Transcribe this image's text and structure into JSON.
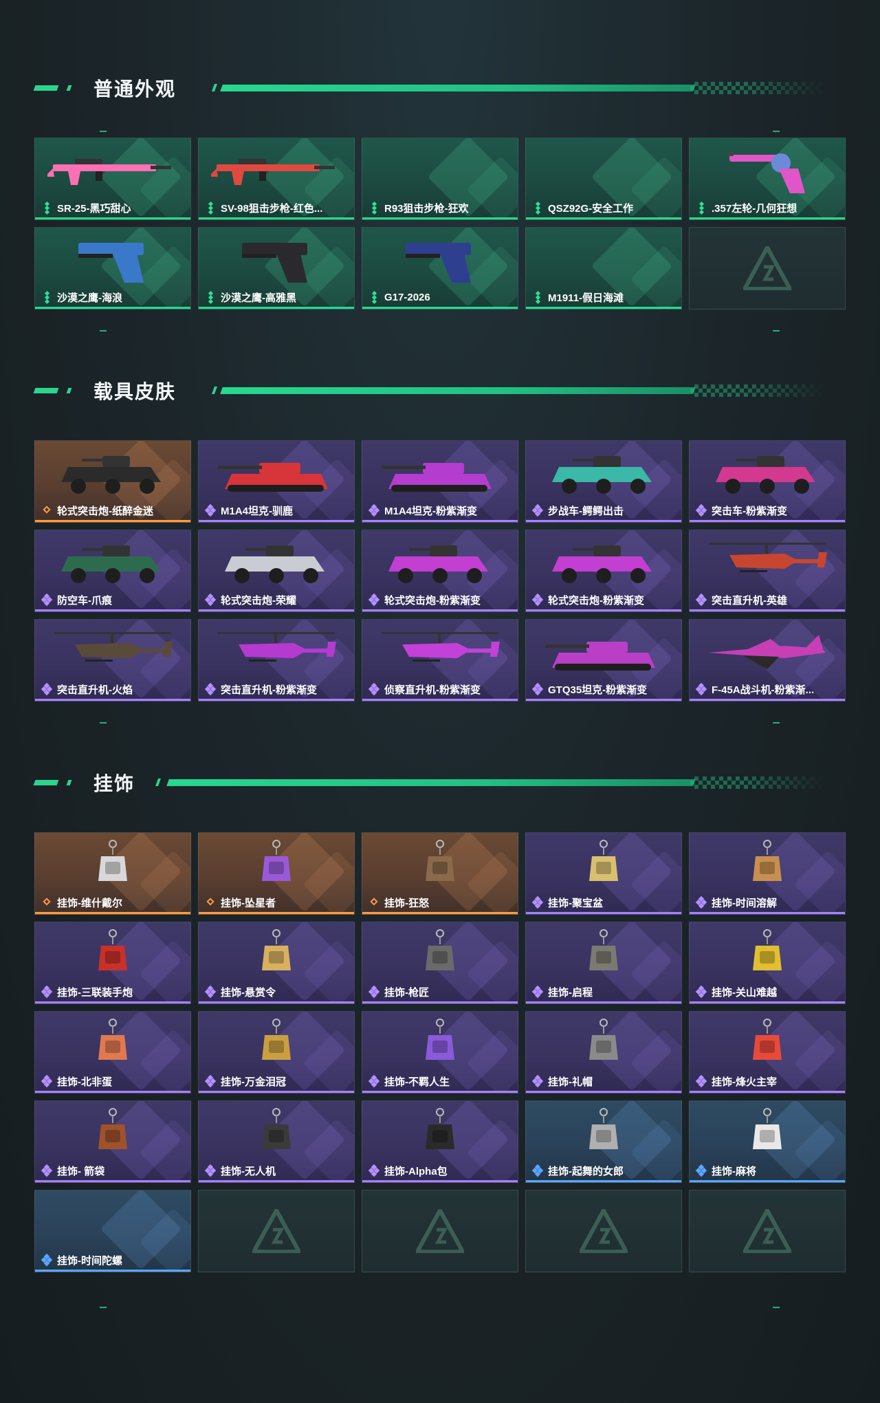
{
  "sections": [
    {
      "title": "普通外观",
      "items": [
        {
          "name": "SR-25-黑巧甜心",
          "tier": "green",
          "icon": "pink-rifle-icon",
          "color": "#ff6fb4"
        },
        {
          "name": "SV-98狙击步枪-红色...",
          "tier": "green",
          "icon": "red-sniper-rifle-icon",
          "color": "#e0493f"
        },
        {
          "name": "R93狙击步枪-狂欢",
          "tier": "green",
          "icon": "",
          "color": ""
        },
        {
          "name": "QSZ92G-安全工作",
          "tier": "green",
          "icon": "",
          "color": ""
        },
        {
          "name": ".357左轮-几何狂想",
          "tier": "green",
          "icon": "revolver-icon",
          "color": "#e056c8"
        },
        {
          "name": "沙漠之鹰-海浪",
          "tier": "green",
          "icon": "blue-pistol-icon",
          "color": "#3a79c9"
        },
        {
          "name": "沙漠之鹰-高雅黑",
          "tier": "green",
          "icon": "black-pistol-icon",
          "color": "#2a2a2e"
        },
        {
          "name": "G17-2026",
          "tier": "green",
          "icon": "navy-pistol-icon",
          "color": "#2e3f8f"
        },
        {
          "name": "M1911-假日海滩",
          "tier": "green",
          "icon": "",
          "color": ""
        },
        {
          "name": "",
          "tier": "empty",
          "icon": "empty-slot-logo-icon",
          "color": ""
        }
      ]
    },
    {
      "title": "载具皮肤",
      "items": [
        {
          "name": "轮式突击炮-纸醉金迷",
          "tier": "gold",
          "icon": "armored-car-icon",
          "color": "#2b2b2b"
        },
        {
          "name": "M1A4坦克-驯鹿",
          "tier": "purple",
          "icon": "tank-icon",
          "color": "#d7353a"
        },
        {
          "name": "M1A4坦克-粉紫渐变",
          "tier": "purple",
          "icon": "tank-icon",
          "color": "#b43ccf"
        },
        {
          "name": "步战车-鳄鳄出击",
          "tier": "purple",
          "icon": "ifv-icon",
          "color": "#3bb8a8"
        },
        {
          "name": "突击车-粉紫渐变",
          "tier": "purple",
          "icon": "assault-vehicle-icon",
          "color": "#d2398f"
        },
        {
          "name": "防空车-爪痕",
          "tier": "purple",
          "icon": "aa-vehicle-icon",
          "color": "#2d6b4f"
        },
        {
          "name": "轮式突击炮-荣耀",
          "tier": "purple",
          "icon": "armored-car-icon",
          "color": "#c9ccd2"
        },
        {
          "name": "轮式突击炮-粉紫渐变",
          "tier": "purple",
          "icon": "armored-car-icon",
          "color": "#c23fd1"
        },
        {
          "name": "轮式突击炮-粉紫渐变",
          "tier": "purple",
          "icon": "armored-car-icon",
          "color": "#c23fd1"
        },
        {
          "name": "突击直升机-英雄",
          "tier": "purple",
          "icon": "helicopter-icon",
          "color": "#c8462f"
        },
        {
          "name": "突击直升机-火焰",
          "tier": "purple",
          "icon": "helicopter-icon",
          "color": "#5a4a3a"
        },
        {
          "name": "突击直升机-粉紫渐变",
          "tier": "purple",
          "icon": "helicopter-icon",
          "color": "#b53ad0"
        },
        {
          "name": "侦察直升机-粉紫渐变",
          "tier": "purple",
          "icon": "scout-helicopter-icon",
          "color": "#c341d8"
        },
        {
          "name": "GTQ35坦克-粉紫渐变",
          "tier": "purple",
          "icon": "tank-icon",
          "color": "#b93fc7"
        },
        {
          "name": "F-45A战斗机-粉紫渐...",
          "tier": "purple",
          "icon": "fighter-jet-icon",
          "color": "#c63fb5"
        }
      ]
    },
    {
      "title": "挂饰",
      "items": [
        {
          "name": "挂饰-维什戴尔",
          "tier": "gold",
          "icon": "tag-charm-icon",
          "color": "#d8d8d8"
        },
        {
          "name": "挂饰-坠星者",
          "tier": "gold",
          "icon": "crystal-charm-icon",
          "color": "#9a5ad8"
        },
        {
          "name": "挂饰-狂怒",
          "tier": "gold",
          "icon": "figure-charm-icon",
          "color": "#8a6a4a"
        },
        {
          "name": "挂饰-聚宝盆",
          "tier": "purple",
          "icon": "treasure-charm-icon",
          "color": "#d8c070"
        },
        {
          "name": "挂饰-时间溶解",
          "tier": "purple",
          "icon": "clock-charm-icon",
          "color": "#c89050"
        },
        {
          "name": "挂饰-三联装手炮",
          "tier": "purple",
          "icon": "cannon-charm-icon",
          "color": "#c8302a"
        },
        {
          "name": "挂饰-悬赏令",
          "tier": "purple",
          "icon": "poster-charm-icon",
          "color": "#d8b060"
        },
        {
          "name": "挂饰-枪匠",
          "tier": "purple",
          "icon": "bag-charm-icon",
          "color": "#6a6a6a"
        },
        {
          "name": "挂饰-启程",
          "tier": "purple",
          "icon": "compass-charm-icon",
          "color": "#7a7a70"
        },
        {
          "name": "挂饰-关山难越",
          "tier": "purple",
          "icon": "bullet-charm-icon",
          "color": "#e0c030"
        },
        {
          "name": "挂饰-北非蛋",
          "tier": "purple",
          "icon": "egg-charm-icon",
          "color": "#e07850"
        },
        {
          "name": "挂饰-万金泪冠",
          "tier": "purple",
          "icon": "crown-charm-icon",
          "color": "#c8a040"
        },
        {
          "name": "挂饰-不羁人生",
          "tier": "purple",
          "icon": "shoe-charm-icon",
          "color": "#8a5ad8"
        },
        {
          "name": "挂饰-礼帽",
          "tier": "purple",
          "icon": "hat-charm-icon",
          "color": "#8a8a8a"
        },
        {
          "name": "挂饰-烽火主宰",
          "tier": "purple",
          "icon": "banner-charm-icon",
          "color": "#e84a3a"
        },
        {
          "name": "挂饰- 箭袋",
          "tier": "purple",
          "icon": "quiver-charm-icon",
          "color": "#a0522d"
        },
        {
          "name": "挂饰-无人机",
          "tier": "purple",
          "icon": "drone-charm-icon",
          "color": "#3a3a3a"
        },
        {
          "name": "挂饰-Alpha包",
          "tier": "purple",
          "icon": "pouch-charm-icon",
          "color": "#2a2a2a"
        },
        {
          "name": "挂饰-起舞的女郎",
          "tier": "blue",
          "icon": "dancer-charm-icon",
          "color": "#b0b0b0"
        },
        {
          "name": "挂饰-麻将",
          "tier": "blue",
          "icon": "mahjong-charm-icon",
          "color": "#e8e8e8"
        },
        {
          "name": "挂饰-时间陀螺",
          "tier": "blue",
          "icon": "",
          "color": ""
        },
        {
          "name": "",
          "tier": "empty",
          "icon": "empty-slot-logo-icon",
          "color": ""
        },
        {
          "name": "",
          "tier": "empty",
          "icon": "empty-slot-logo-icon",
          "color": ""
        },
        {
          "name": "",
          "tier": "empty",
          "icon": "empty-slot-logo-icon",
          "color": ""
        },
        {
          "name": "",
          "tier": "empty",
          "icon": "empty-slot-logo-icon",
          "color": ""
        }
      ]
    }
  ],
  "colors": {
    "accent": "#2bd58e",
    "green_tier": "#28d78f",
    "purple_tier": "#a780ff",
    "gold_tier": "#ff9a3c",
    "blue_tier": "#5aa7ff"
  }
}
